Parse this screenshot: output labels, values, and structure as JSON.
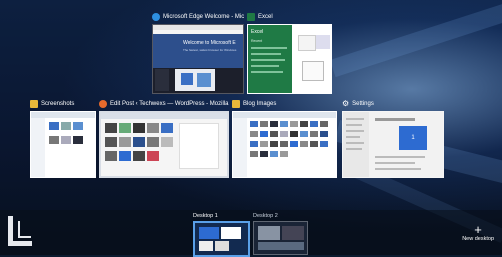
{
  "windows": {
    "edge": {
      "title": "Microsoft Edge Welcome - Micro...",
      "icon": "edge-icon",
      "banner": "Welcome to Microsoft E",
      "banner_sub": "The fastest, safest browser for Windows"
    },
    "excel": {
      "title": "Excel",
      "icon": "excel-icon",
      "app_name": "Excel",
      "recent_label": "Recent"
    },
    "screenshots": {
      "title": "Screenshots",
      "icon": "folder-icon"
    },
    "firefox": {
      "title": "Edit Post ‹ Techwexs — WordPress - Mozilla Firefox",
      "icon": "firefox-icon"
    },
    "blog": {
      "title": "Blog Images",
      "icon": "folder-icon"
    },
    "settings": {
      "title": "Settings",
      "icon": "gear-icon",
      "display_number": "1"
    }
  },
  "desktops": [
    {
      "label": "Desktop 1",
      "active": true
    },
    {
      "label": "Desktop 2",
      "active": false
    }
  ],
  "new_desktop": {
    "label": "New desktop",
    "icon": "plus-icon"
  },
  "colors": {
    "edge_blue": "#2d6bd1",
    "excel_green": "#1f7a45",
    "folder_yellow": "#e8b83a",
    "selected_border": "#5aa0e8"
  }
}
